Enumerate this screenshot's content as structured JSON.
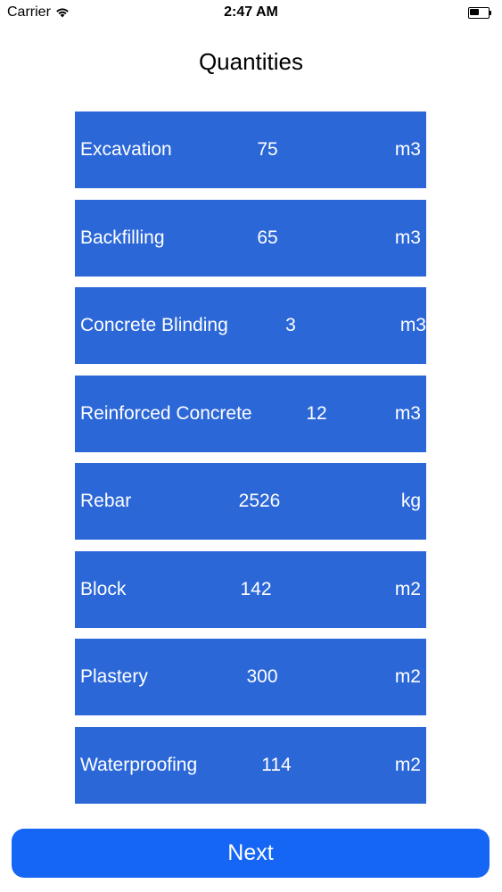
{
  "status_bar": {
    "carrier": "Carrier",
    "time": "2:47 AM",
    "wifi_icon": "wifi-icon",
    "battery_icon": "battery-icon"
  },
  "header": {
    "title": "Quantities"
  },
  "quantities": [
    {
      "name": "Excavation",
      "value": "75",
      "unit": "m3"
    },
    {
      "name": "Backfilling",
      "value": "65",
      "unit": "m3"
    },
    {
      "name": "Concrete Blinding",
      "value": "3",
      "unit": "m3"
    },
    {
      "name": "Reinforced Concrete",
      "value": "12",
      "unit": "m3"
    },
    {
      "name": "Rebar",
      "value": "2526",
      "unit": "kg"
    },
    {
      "name": "Block",
      "value": "142",
      "unit": "m2"
    },
    {
      "name": "Plastery",
      "value": "300",
      "unit": "m2"
    },
    {
      "name": "Waterproofing",
      "value": "114",
      "unit": "m2"
    }
  ],
  "footer": {
    "next_label": "Next"
  },
  "colors": {
    "row_background": "#2c67d8",
    "button_background": "#1666f5",
    "text_on_blue": "#ffffff"
  }
}
